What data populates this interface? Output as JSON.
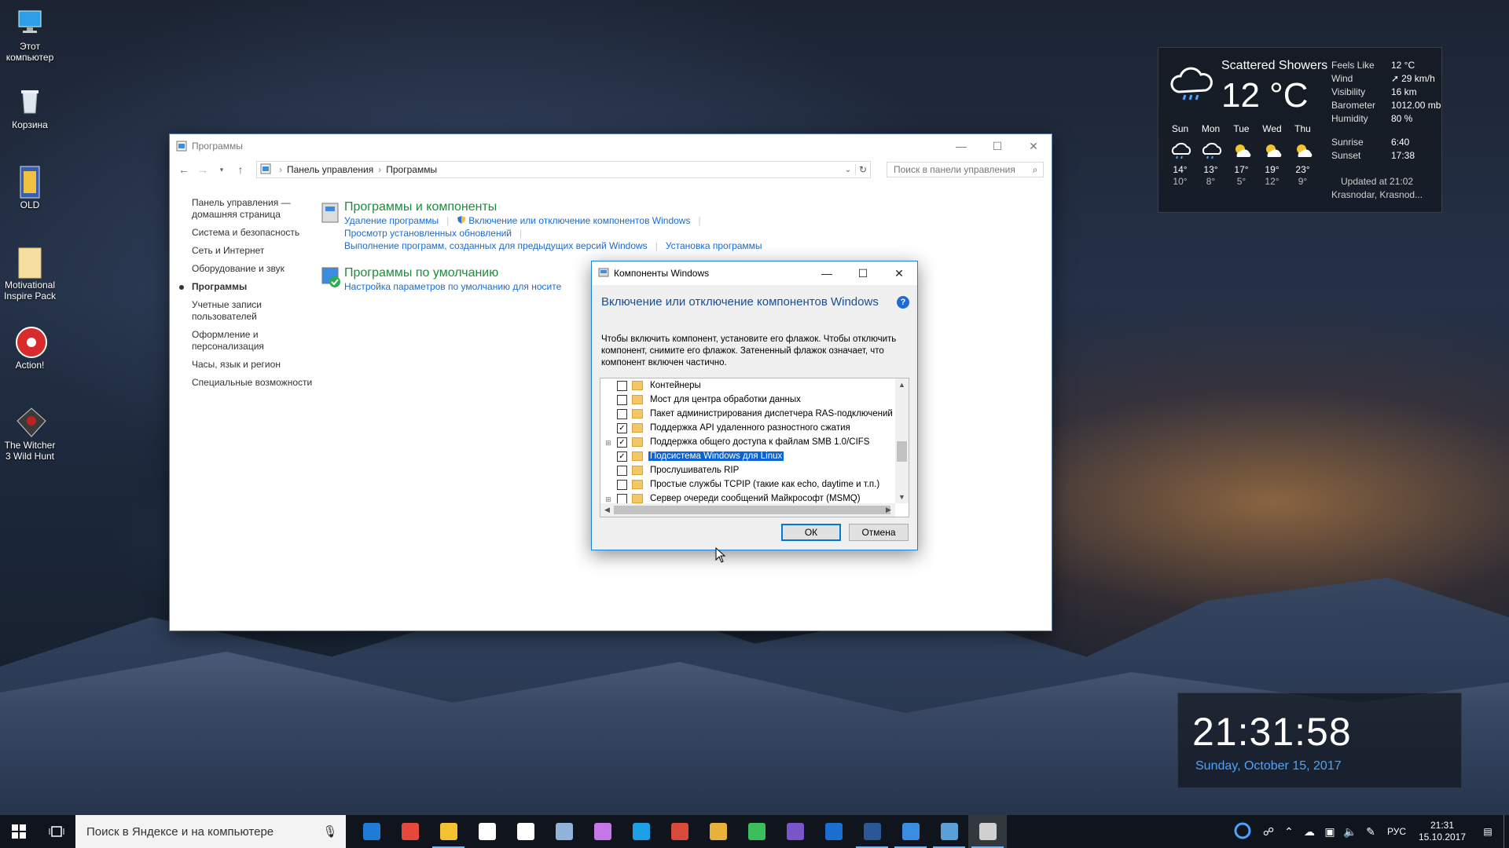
{
  "desktop": {
    "icons": [
      {
        "label": "Этот компьютер"
      },
      {
        "label": "Корзина"
      },
      {
        "label": "OLD"
      },
      {
        "label": "Motivational Inspire Pack"
      },
      {
        "label": "Action!"
      },
      {
        "label": "The Witcher 3 Wild Hunt"
      }
    ]
  },
  "weather": {
    "condition": "Scattered Showers",
    "temp": "12 °C",
    "details": [
      {
        "k": "Feels Like",
        "v": "12 °C"
      },
      {
        "k": "Wind",
        "v": "29 km/h"
      },
      {
        "k": "Visibility",
        "v": "16 km"
      },
      {
        "k": "Barometer",
        "v": "1012.00 mb"
      },
      {
        "k": "Humidity",
        "v": "80 %"
      }
    ],
    "sun": [
      {
        "k": "Sunrise",
        "v": "6:40"
      },
      {
        "k": "Sunset",
        "v": "17:38"
      }
    ],
    "updated": "Updated at 21:02",
    "location": "Krasnodar, Krasnod...",
    "forecast": [
      {
        "day": "Sun",
        "hi": "14°",
        "lo": "10°",
        "icon": "rain-icon"
      },
      {
        "day": "Mon",
        "hi": "13°",
        "lo": "8°",
        "icon": "rain-icon"
      },
      {
        "day": "Tue",
        "hi": "17°",
        "lo": "5°",
        "icon": "partly-cloudy-icon"
      },
      {
        "day": "Wed",
        "hi": "19°",
        "lo": "12°",
        "icon": "partly-cloudy-icon"
      },
      {
        "day": "Thu",
        "hi": "23°",
        "lo": "9°",
        "icon": "partly-cloudy-icon"
      }
    ]
  },
  "clock": {
    "time": "21:31:58",
    "date": "Sunday, October 15, 2017"
  },
  "explorer": {
    "title": "Программы",
    "breadcrumb": [
      "Панель управления",
      "Программы"
    ],
    "search_placeholder": "Поиск в панели управления",
    "sidebar": [
      {
        "label": "Панель управления — домашняя страница",
        "active": false
      },
      {
        "label": "Система и безопасность",
        "active": false
      },
      {
        "label": "Сеть и Интернет",
        "active": false
      },
      {
        "label": "Оборудование и звук",
        "active": false
      },
      {
        "label": "Программы",
        "active": true
      },
      {
        "label": "Учетные записи пользователей",
        "active": false
      },
      {
        "label": "Оформление и персонализация",
        "active": false
      },
      {
        "label": "Часы, язык и регион",
        "active": false
      },
      {
        "label": "Специальные возможности",
        "active": false
      }
    ],
    "cat1": {
      "heading": "Программы и компоненты",
      "link1": "Удаление программы",
      "link2": "Включение или отключение компонентов Windows",
      "link3": "Просмотр установленных обновлений",
      "link4": "Выполнение программ, созданных для предыдущих версий Windows",
      "link5": "Установка программы"
    },
    "cat2": {
      "heading": "Программы по умолчанию",
      "link1": "Настройка параметров по умолчанию для носите"
    }
  },
  "dialog": {
    "title": "Компоненты Windows",
    "heading": "Включение или отключение компонентов Windows",
    "description": "Чтобы включить компонент, установите его флажок. Чтобы отключить компонент, снимите его флажок. Затененный флажок означает, что компонент включен частично.",
    "items": [
      {
        "label": "Контейнеры",
        "checked": false,
        "expandable": false,
        "selected": false
      },
      {
        "label": "Мост для центра обработки данных",
        "checked": false,
        "expandable": false,
        "selected": false
      },
      {
        "label": "Пакет администрирования диспетчера RAS-подключений",
        "checked": false,
        "expandable": false,
        "selected": false
      },
      {
        "label": "Поддержка API удаленного разностного сжатия",
        "checked": true,
        "expandable": false,
        "selected": false
      },
      {
        "label": "Поддержка общего доступа к файлам SMB 1.0/CIFS",
        "checked": true,
        "expandable": true,
        "selected": false
      },
      {
        "label": "Подсистема Windows для Linux",
        "checked": true,
        "expandable": false,
        "selected": true
      },
      {
        "label": "Прослушиватель RIP",
        "checked": false,
        "expandable": false,
        "selected": false
      },
      {
        "label": "Простые службы TCPIP (такие как echo, daytime и т.п.)",
        "checked": false,
        "expandable": false,
        "selected": false
      },
      {
        "label": "Сервер очереди сообщений Майкрософт (MSMQ)",
        "checked": false,
        "expandable": true,
        "selected": false
      }
    ],
    "ok": "ОК",
    "cancel": "Отмена"
  },
  "taskbar": {
    "search_placeholder": "Поиск в Яндексе и на компьютере",
    "apps": [
      {
        "name": "edge-icon",
        "color": "#1e7bd6"
      },
      {
        "name": "chrome-icon",
        "color": "#e4493b"
      },
      {
        "name": "explorer-icon",
        "color": "#f2c230"
      },
      {
        "name": "store-icon",
        "color": "#ffffff"
      },
      {
        "name": "mail-icon",
        "color": "#ffffff"
      },
      {
        "name": "steam-icon",
        "color": "#8fb3d9"
      },
      {
        "name": "maps-icon",
        "color": "#c478e8"
      },
      {
        "name": "skype-icon",
        "color": "#1ea0e6"
      },
      {
        "name": "app-icon",
        "color": "#d94a3a"
      },
      {
        "name": "app-icon",
        "color": "#e8b13a"
      },
      {
        "name": "speed-icon",
        "color": "#3bbf5a"
      },
      {
        "name": "app-icon",
        "color": "#7a54c9"
      },
      {
        "name": "v-icon",
        "color": "#1c6fd1"
      },
      {
        "name": "word-icon",
        "color": "#2b5797"
      },
      {
        "name": "control-panel-icon",
        "color": "#3a8de0"
      },
      {
        "name": "app-icon",
        "color": "#5aa0d8"
      },
      {
        "name": "features-icon",
        "color": "#d0d0d0"
      }
    ],
    "lang": "РУС",
    "time": "21:31",
    "date": "15.10.2017"
  }
}
